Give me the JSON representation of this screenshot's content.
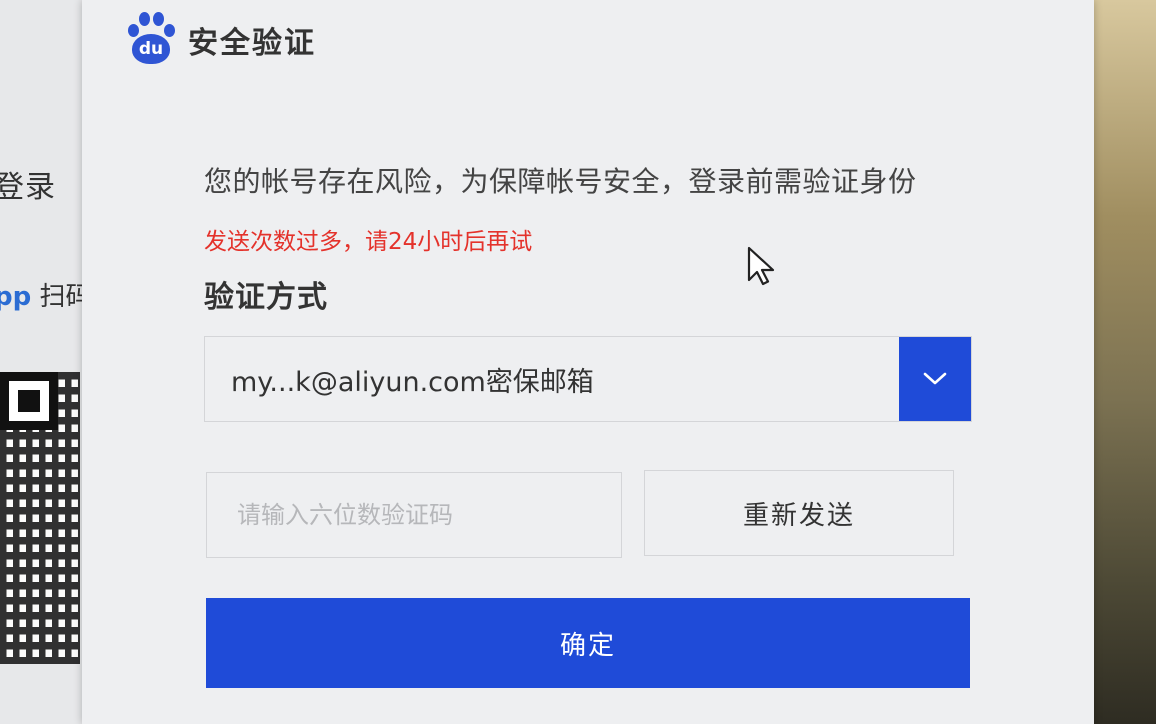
{
  "background": {
    "login_text": "登录",
    "app_highlight": "pp",
    "app_text": " 扫码"
  },
  "dialog": {
    "title": "安全验证",
    "logo_text": "du",
    "description": "您的帐号存在风险，为保障帐号安全，登录前需验证身份",
    "error_message": "发送次数过多，请24小时后再试",
    "method_label": "验证方式",
    "method_selected": "my...k@aliyun.com密保邮箱",
    "code_placeholder": "请输入六位数验证码",
    "code_value": "",
    "resend_label": "重新发送",
    "confirm_label": "确定"
  },
  "colors": {
    "brand_blue": "#1f4bd8",
    "error_red": "#e4322b",
    "logo_blue": "#2f55d4"
  },
  "icons": {
    "logo": "baidu-paw-icon",
    "dropdown": "chevron-down-icon",
    "pointer": "mouse-cursor-icon"
  }
}
